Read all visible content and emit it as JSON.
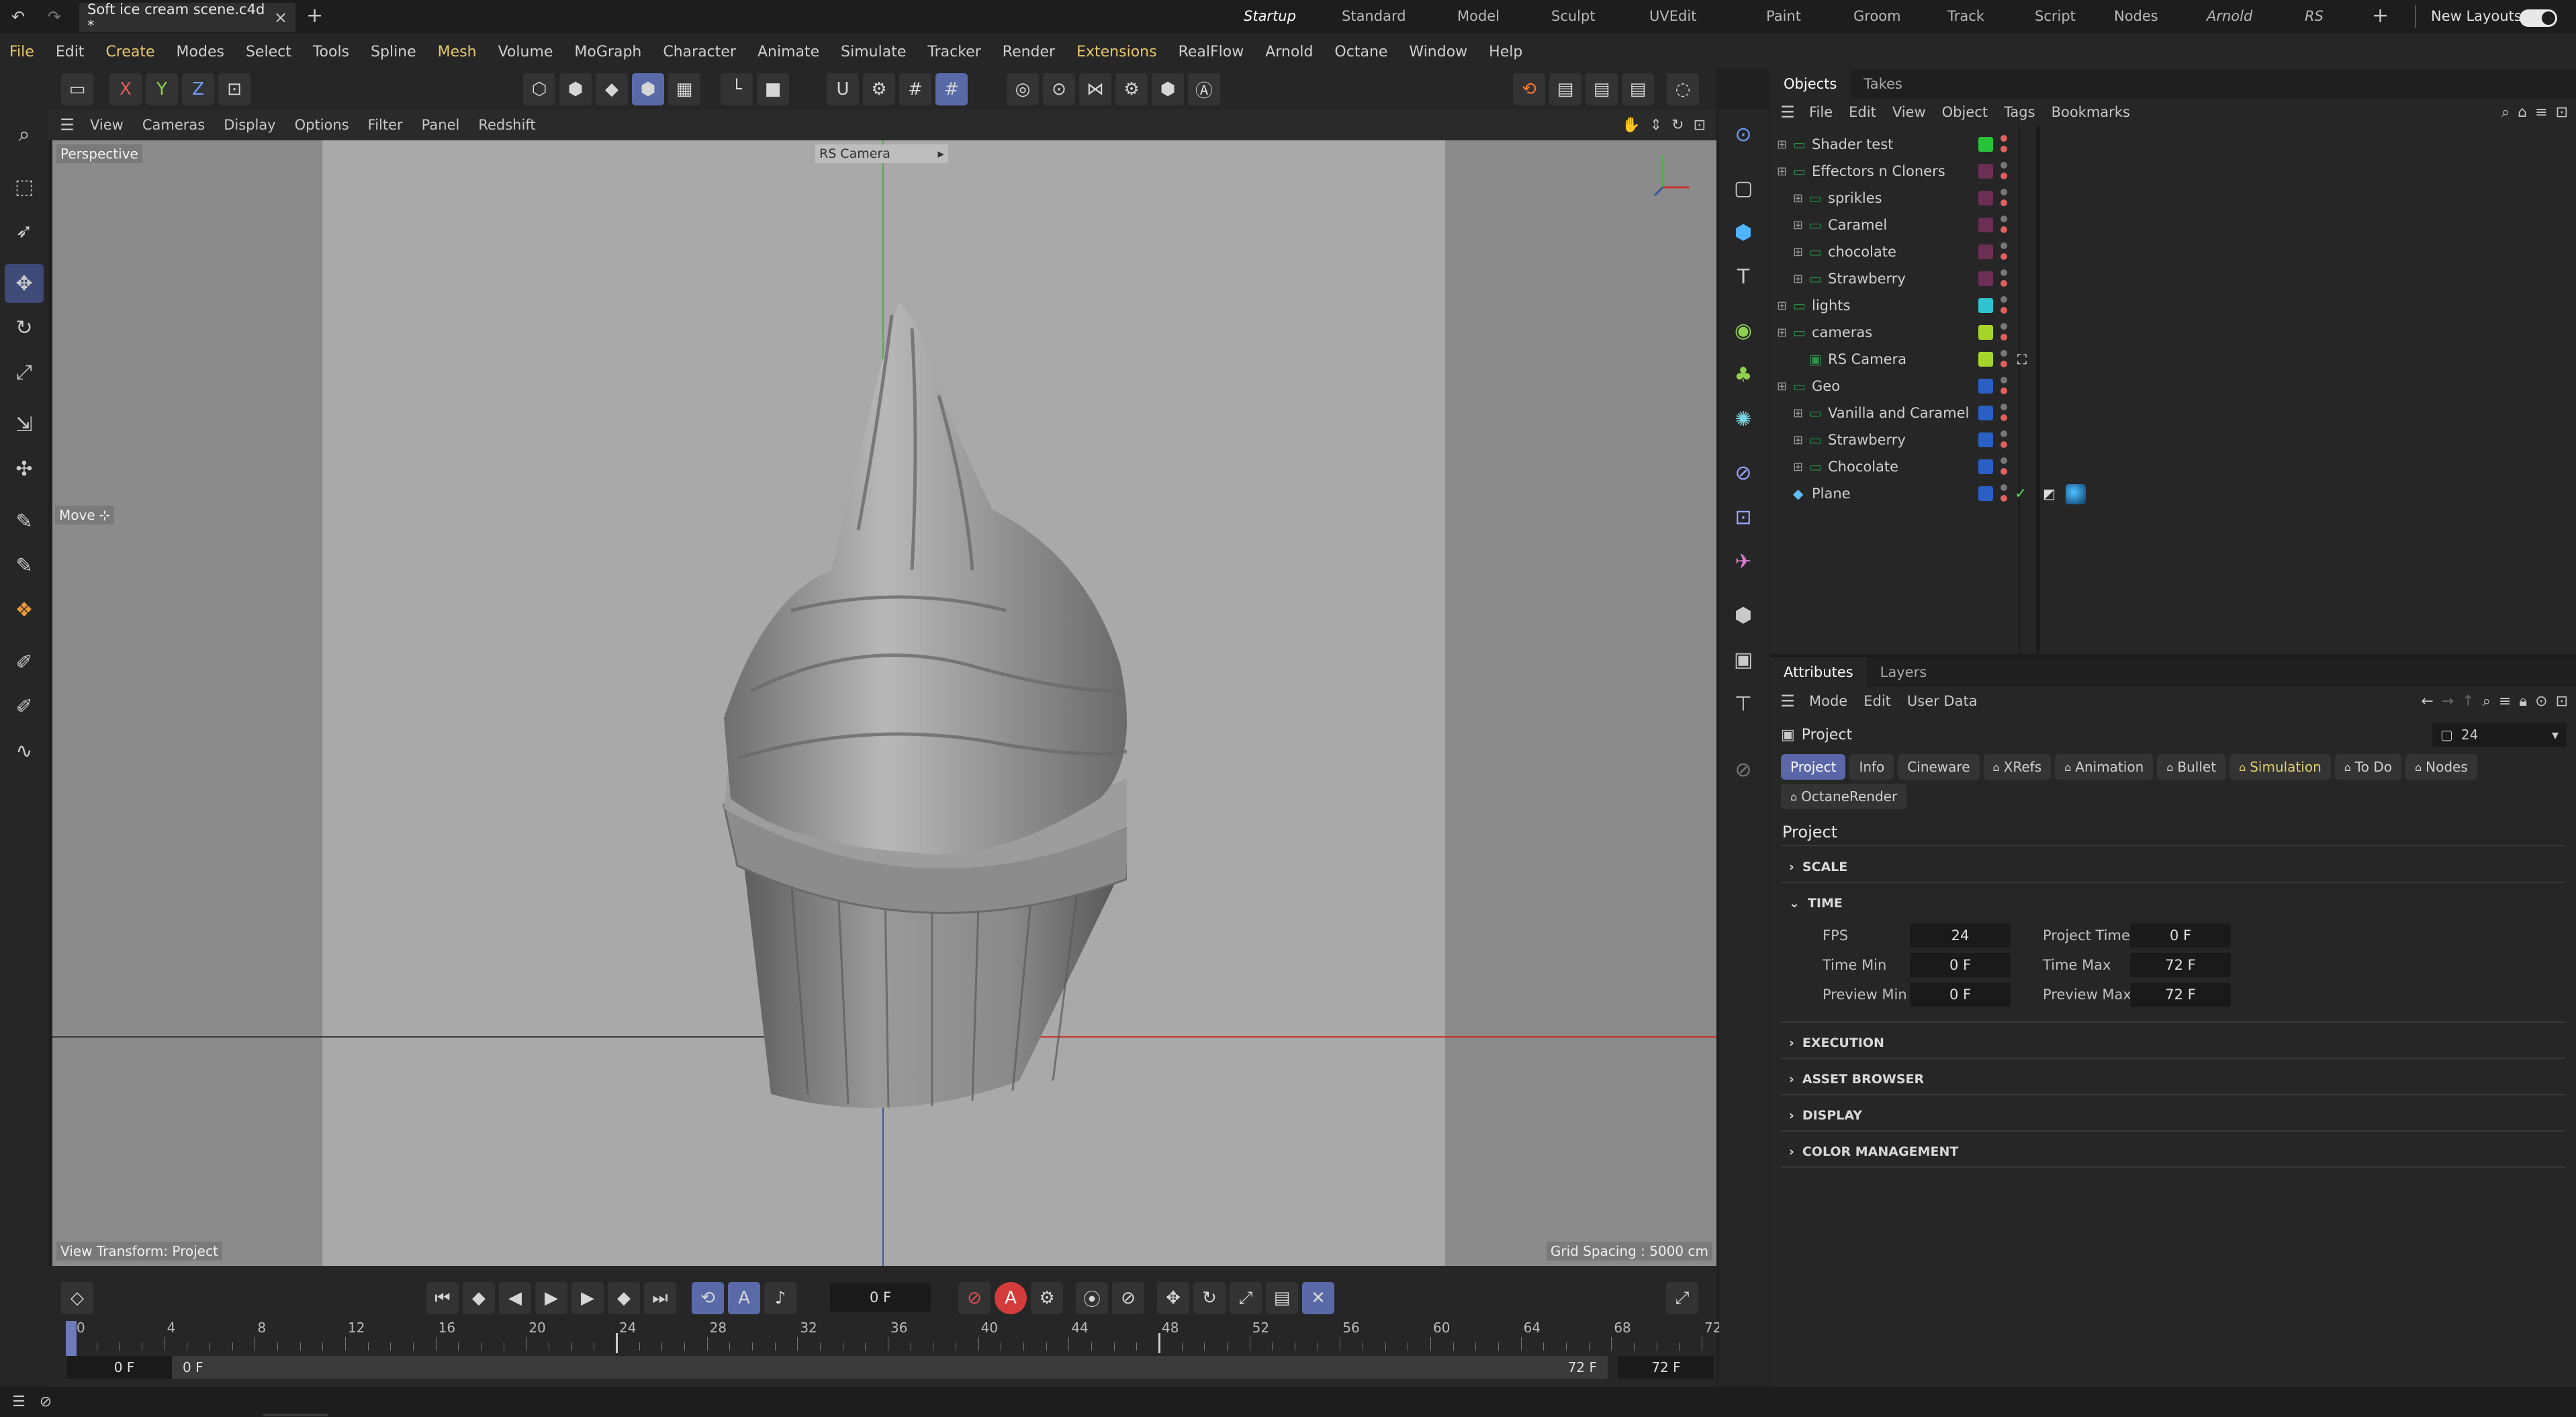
{
  "title_tabs": {
    "doc": "Soft ice cream scene.c4d *",
    "close": "×",
    "add": "+"
  },
  "layouts": [
    "Startup",
    "Standard",
    "Model",
    "Sculpt",
    "UVEdit",
    "Paint",
    "Groom",
    "Track",
    "Script",
    "Nodes",
    "Arnold",
    "RS"
  ],
  "new_layouts": "New Layouts",
  "menu": [
    "File",
    "Edit",
    "Create",
    "Modes",
    "Select",
    "Tools",
    "Spline",
    "Mesh",
    "Volume",
    "MoGraph",
    "Character",
    "Animate",
    "Simulate",
    "Tracker",
    "Render",
    "Extensions",
    "RealFlow",
    "Arnold",
    "Octane",
    "Window",
    "Help"
  ],
  "axes": {
    "x": "X",
    "y": "Y",
    "z": "Z"
  },
  "viewport": {
    "menu": [
      "View",
      "Cameras",
      "Display",
      "Options",
      "Filter",
      "Panel",
      "Redshift"
    ],
    "label": "Perspective",
    "camera": "RS Camera",
    "move_hud": "Move",
    "view_transform": "View Transform: Project",
    "grid_spacing": "Grid Spacing : 5000 cm"
  },
  "timeline": {
    "current_frame": "0 F",
    "ticks": [
      "0",
      "4",
      "8",
      "12",
      "16",
      "20",
      "24",
      "28",
      "32",
      "36",
      "40",
      "44",
      "48",
      "52",
      "56",
      "60",
      "64",
      "68",
      "72"
    ],
    "start": "0 F",
    "range_start": "0 F",
    "range_end": "72 F",
    "end": "72 F"
  },
  "objects_panel": {
    "tabs": [
      "Objects",
      "Takes"
    ],
    "menu": [
      "File",
      "Edit",
      "View",
      "Object",
      "Tags",
      "Bookmarks"
    ],
    "rows": [
      {
        "name": "Shader test",
        "indent": 0,
        "color": "#27c43a"
      },
      {
        "name": "Effectors n Cloners",
        "indent": 0,
        "color": "#6b2f55"
      },
      {
        "name": "sprikles",
        "indent": 1,
        "color": "#6b2f55"
      },
      {
        "name": "Caramel",
        "indent": 1,
        "color": "#6b2f55"
      },
      {
        "name": "chocolate",
        "indent": 1,
        "color": "#6b2f55"
      },
      {
        "name": "Strawberry",
        "indent": 1,
        "color": "#6b2f55"
      },
      {
        "name": "lights",
        "indent": 0,
        "color": "#2ec4d0"
      },
      {
        "name": "cameras",
        "indent": 0,
        "color": "#a6d42a"
      },
      {
        "name": "RS Camera",
        "indent": 1,
        "color": "#a6d42a"
      },
      {
        "name": "Geo",
        "indent": 0,
        "color": "#2a5fc4"
      },
      {
        "name": "Vanilla and Caramel",
        "indent": 1,
        "color": "#2a5fc4"
      },
      {
        "name": "Strawberry",
        "indent": 1,
        "color": "#2a5fc4"
      },
      {
        "name": "Chocolate",
        "indent": 1,
        "color": "#2a5fc4"
      },
      {
        "name": "Plane",
        "indent": 0,
        "color": "#2a5fc4"
      }
    ]
  },
  "attributes": {
    "tabs": [
      "Attributes",
      "Layers"
    ],
    "menu": [
      "Mode",
      "Edit",
      "User Data"
    ],
    "object": "Project",
    "fps_dropdown": "24",
    "chips": [
      "Project",
      "Info",
      "Cineware",
      "XRefs",
      "Animation",
      "Bullet",
      "Simulation",
      "To Do",
      "Nodes",
      "OctaneRender"
    ],
    "heading": "Project",
    "sections": [
      "SCALE",
      "TIME",
      "EXECUTION",
      "ASSET BROWSER",
      "DISPLAY",
      "COLOR MANAGEMENT"
    ],
    "fields": {
      "fps_label": "FPS",
      "fps": "24",
      "project_time_label": "Project Time",
      "project_time": "0 F",
      "time_min_label": "Time Min",
      "time_min": "0 F",
      "time_max_label": "Time Max",
      "time_max": "72 F",
      "preview_min_label": "Preview Min",
      "preview_min": "0 F",
      "preview_max_label": "Preview Max",
      "preview_max": "72 F"
    }
  }
}
